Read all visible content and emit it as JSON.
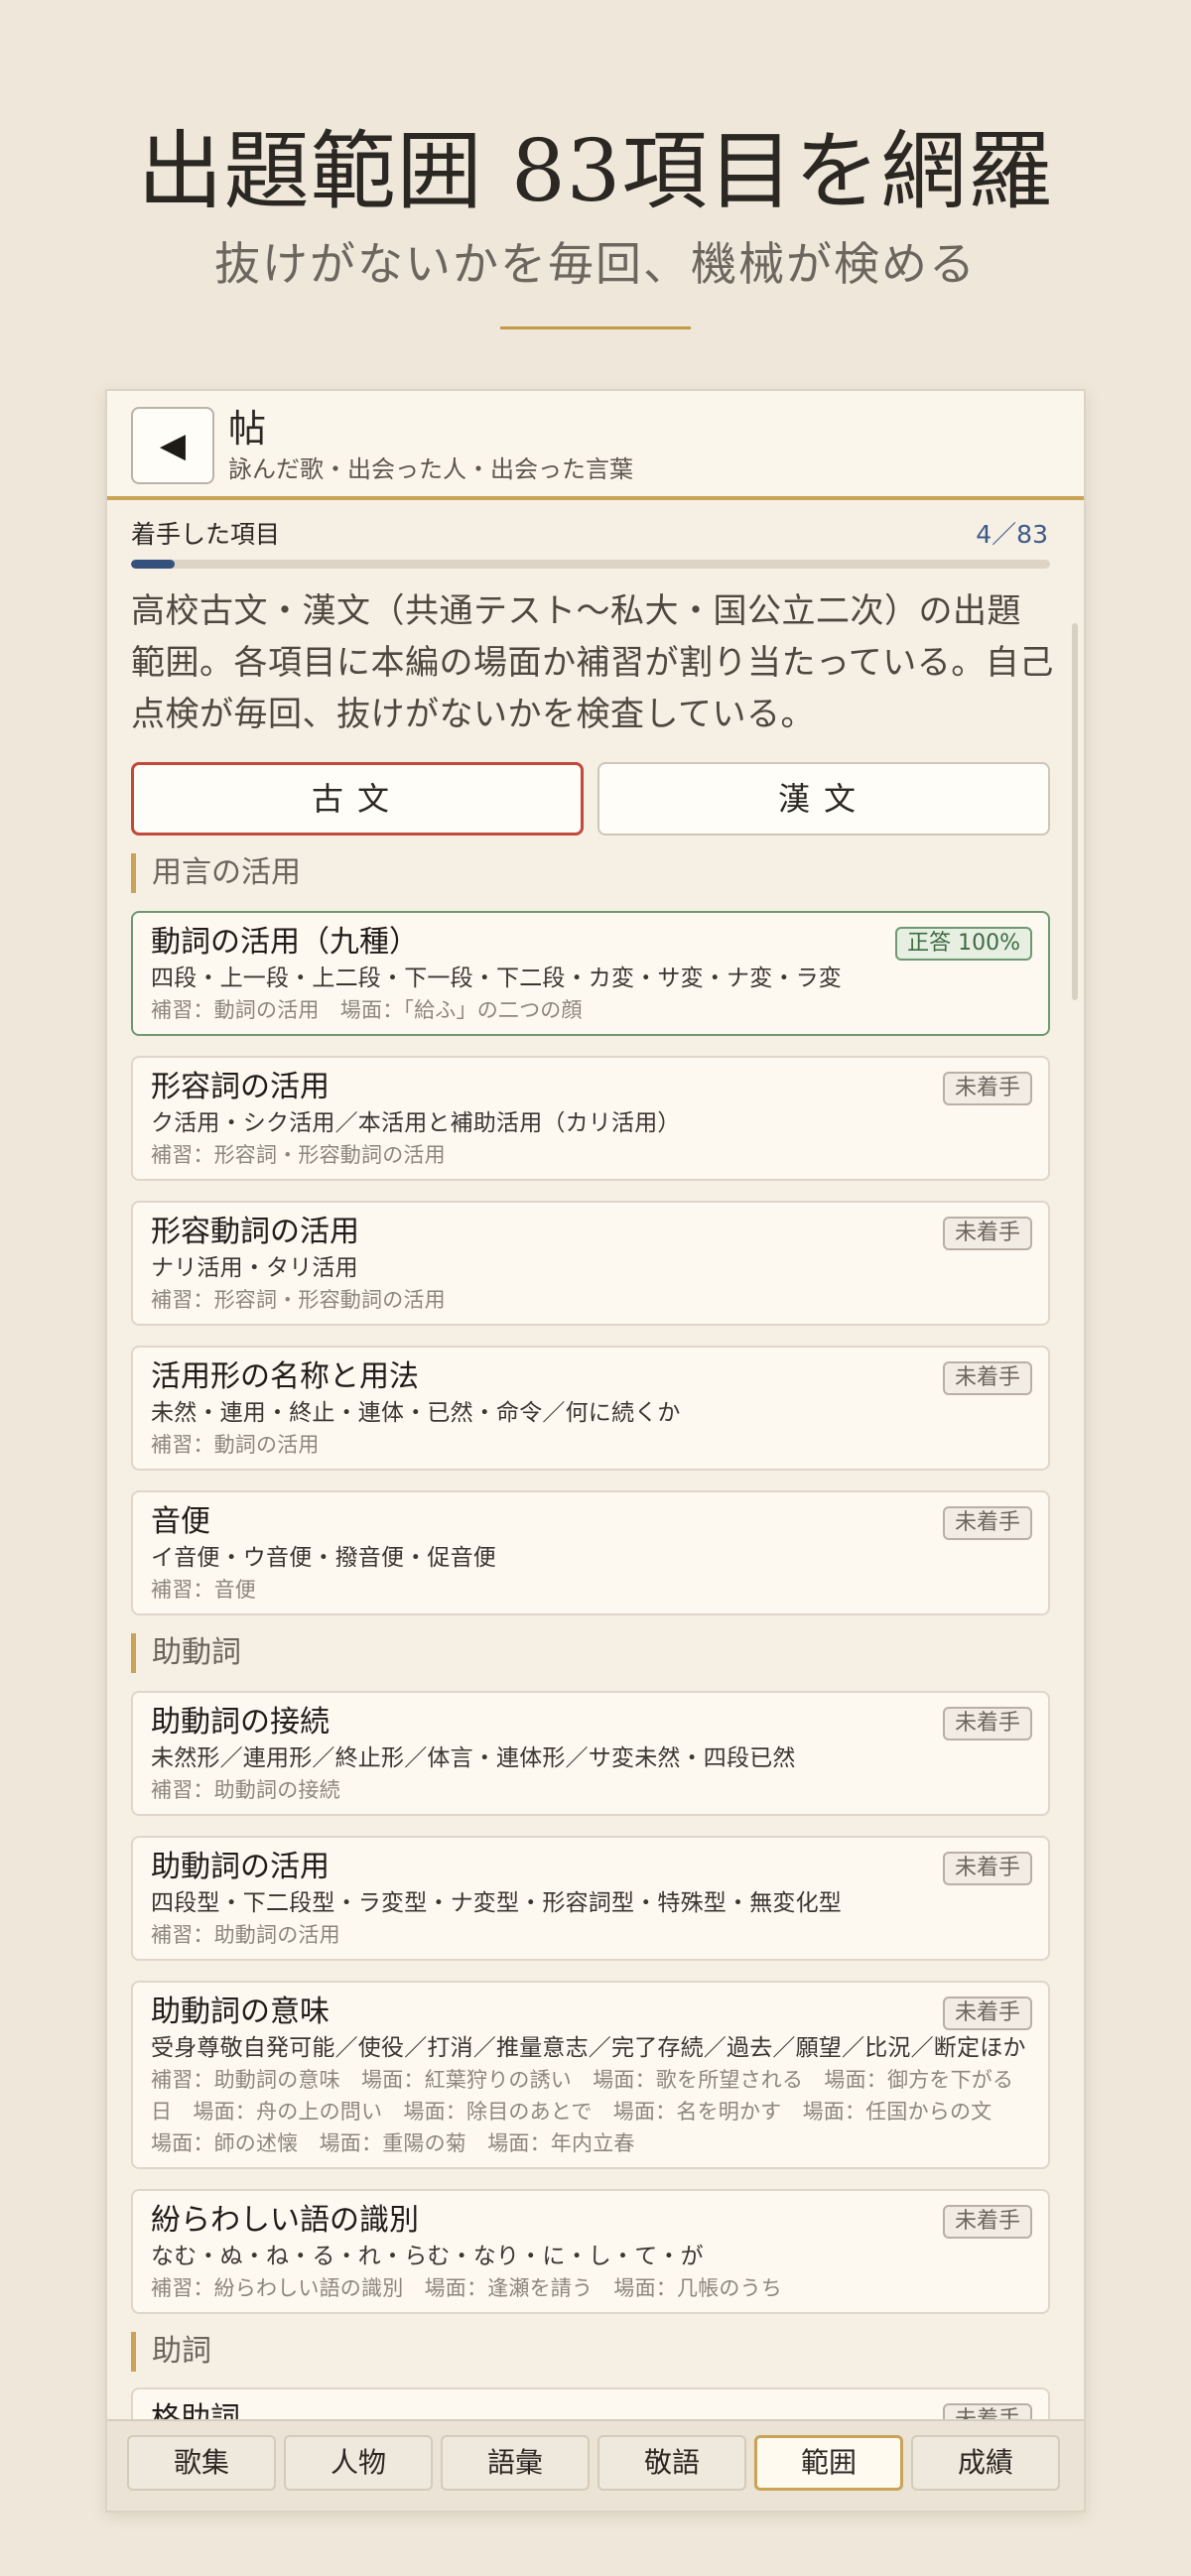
{
  "hero": {
    "title": "出題範囲 83項目を網羅",
    "subtitle": "抜けがないかを毎回、機械が検める"
  },
  "header": {
    "back_icon": "◀",
    "title": "帖",
    "subtitle": "詠んだ歌・出会った人・出会った言葉"
  },
  "progress": {
    "label": "着手した項目",
    "count": "4／83",
    "fraction": 0.048
  },
  "intro": "高校古文・漢文（共通テスト〜私大・国公立二次）の出題範囲。各項目に本編の場面か補習が割り当たっている。自己点検が毎回、抜けがないかを検査している。",
  "segments": {
    "kobun": "古文",
    "kanbun": "漢文",
    "selected": "kobun"
  },
  "sections": [
    {
      "title": "用言の活用"
    },
    {
      "title": "助動詞"
    },
    {
      "title": "助詞"
    }
  ],
  "cards": [
    {
      "title": "動詞の活用（九種）",
      "desc": "四段・上一段・上二段・下一段・下二段・カ変・サ変・ナ変・ラ変",
      "note": "補習：動詞の活用　場面：「給ふ」の二つの顔",
      "badge": "正答 100%"
    },
    {
      "title": "形容詞の活用",
      "desc": "ク活用・シク活用／本活用と補助活用（カリ活用）",
      "note": "補習：形容詞・形容動詞の活用",
      "badge": "未着手"
    },
    {
      "title": "形容動詞の活用",
      "desc": "ナリ活用・タリ活用",
      "note": "補習：形容詞・形容動詞の活用",
      "badge": "未着手"
    },
    {
      "title": "活用形の名称と用法",
      "desc": "未然・連用・終止・連体・已然・命令／何に続くか",
      "note": "補習：動詞の活用",
      "badge": "未着手"
    },
    {
      "title": "音便",
      "desc": "イ音便・ウ音便・撥音便・促音便",
      "note": "補習：音便",
      "badge": "未着手"
    },
    {
      "title": "助動詞の接続",
      "desc": "未然形／連用形／終止形／体言・連体形／サ変未然・四段已然",
      "note": "補習：助動詞の接続",
      "badge": "未着手"
    },
    {
      "title": "助動詞の活用",
      "desc": "四段型・下二段型・ラ変型・ナ変型・形容詞型・特殊型・無変化型",
      "note": "補習：助動詞の活用",
      "badge": "未着手"
    },
    {
      "title": "助動詞の意味",
      "desc": "受身尊敬自発可能／使役／打消／推量意志／完了存続／過去／願望／比況／断定ほか",
      "note": "補習：助動詞の意味　場面：紅葉狩りの誘い　場面：歌を所望される　場面：御方を下がる日　場面：舟の上の問い　場面：除目のあとで　場面：名を明かす　場面：任国からの文　場面：師の述懐　場面：重陽の菊　場面：年内立春",
      "badge": "未着手"
    },
    {
      "title": "紛らわしい語の識別",
      "desc": "なむ・ぬ・ね・る・れ・らむ・なり・に・し・て・が",
      "note": "補習：紛らわしい語の識別　場面：逢瀬を請う　場面：几帳のうち",
      "badge": "未着手"
    },
    {
      "title": "格助詞",
      "desc": "",
      "note": "",
      "badge": "未着手"
    }
  ],
  "tabs": [
    "歌集",
    "人物",
    "語彙",
    "敬語",
    "範囲",
    "成績"
  ],
  "active_tab": "範囲"
}
